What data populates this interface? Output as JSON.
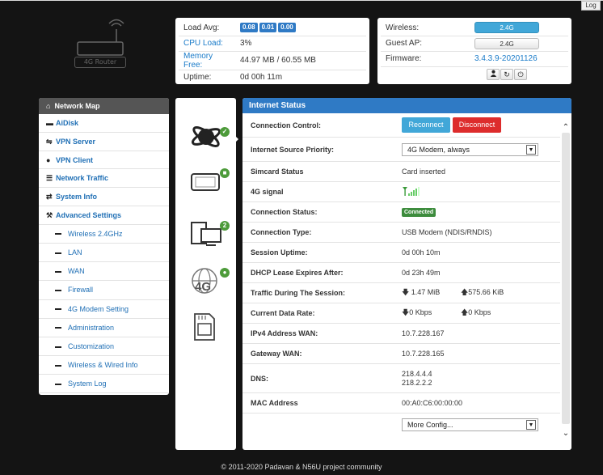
{
  "log_label": "Log",
  "logo": {
    "label": "4G Router"
  },
  "status_left": {
    "rows": [
      {
        "label": "Load Avg:",
        "link": false
      },
      {
        "label": "CPU Load:",
        "value": "3%",
        "link": true
      },
      {
        "label": "Memory Free:",
        "value": "44.97 MB / 60.55 MB",
        "link": true
      },
      {
        "label": "Uptime:",
        "value": "0d 00h 11m",
        "link": false
      }
    ],
    "load_values": [
      "0.08",
      "0.01",
      "0.00"
    ]
  },
  "status_right": {
    "wireless_label": "Wireless:",
    "wireless_btn": "2.4G",
    "guest_label": "Guest AP:",
    "guest_btn": "2.4G",
    "firmware_label": "Firmware:",
    "firmware_value": "3.4.3.9-20201126"
  },
  "sidebar": {
    "header": "Network Map",
    "items": [
      {
        "label": "AiDisk",
        "icon": "disk-icon"
      },
      {
        "label": "VPN Server",
        "icon": "vpn-server-icon"
      },
      {
        "label": "VPN Client",
        "icon": "vpn-client-icon"
      },
      {
        "label": "Network Traffic",
        "icon": "traffic-icon"
      },
      {
        "label": "System Info",
        "icon": "system-info-icon"
      },
      {
        "label": "Advanced Settings",
        "icon": "wrench-icon"
      }
    ],
    "subitems": [
      "Wireless 2.4GHz",
      "LAN",
      "WAN",
      "Firewall",
      "4G Modem Setting",
      "Administration",
      "Customization",
      "Wireless & Wired Info",
      "System Log"
    ]
  },
  "icon_column": {
    "clients_badge": "2"
  },
  "main": {
    "header": "Internet Status",
    "connection_control_label": "Connection Control:",
    "reconnect": "Reconnect",
    "disconnect": "Disconnect",
    "priority_label": "Internet Source Priority:",
    "priority_value": "4G Modem, always",
    "simcard_label": "Simcard Status",
    "simcard_value": "Card inserted",
    "signal_label": "4G signal",
    "conn_status_label": "Connection Status:",
    "conn_status_value": "Connected",
    "conn_type_label": "Connection Type:",
    "conn_type_value": "USB Modem (NDIS/RNDIS)",
    "session_uptime_label": "Session Uptime:",
    "session_uptime_value": "0d 00h 10m",
    "dhcp_label": "DHCP Lease Expires After:",
    "dhcp_value": "0d 23h 49m",
    "traffic_label": "Traffic During The Session:",
    "traffic_down": "1.47 MiB",
    "traffic_up": "575.66 KiB",
    "rate_label": "Current Data Rate:",
    "rate_down": "0 Kbps",
    "rate_up": "0 Kbps",
    "ipv4_label": "IPv4 Address WAN:",
    "ipv4_value": "10.7.228.167",
    "gateway_label": "Gateway WAN:",
    "gateway_value": "10.7.228.165",
    "dns_label": "DNS:",
    "dns_1": "218.4.4.4",
    "dns_2": "218.2.2.2",
    "mac_label": "MAC Address",
    "mac_value": "00:A0:C6:00:00:00",
    "more_config": "More Config..."
  },
  "footer": "© 2011-2020 Padavan & N56U project community",
  "colors": {
    "accent": "#2f7ac5",
    "reconnect": "#41a7d8",
    "disconnect": "#dd2c2c",
    "connected": "#3d8c3d"
  }
}
